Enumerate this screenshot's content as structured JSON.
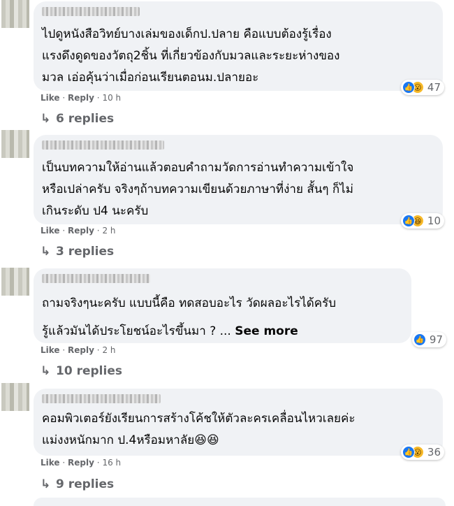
{
  "comments": [
    {
      "lines": [
        "ไปดูหนังสือวิทย์บางเล่มของเด็กป.ปลาย คือแบบต้องรู้เรื่อง",
        "แรงดึงดูดของวัตถุ2ชิ้น ที่เกี่ยวข้องกับมวลและระยะห่างของ",
        "มวล เอ่อคุ้นว่าเมื่อก่อนเรียนตอนม.ปลายอะ"
      ],
      "like": "Like",
      "reply": "Reply",
      "time": "10 h",
      "reaction_count": "47",
      "replies": "6 replies",
      "reaction_icons": [
        "like-icon",
        "wow-icon"
      ]
    },
    {
      "lines": [
        "เป็นบทความให้อ่านแล้วตอบคำถามวัดการอ่านทำความเข้าใจ",
        "หรือเปล่าครับ จริงๆถ้าบทความเขียนด้วยภาษาที่ง่าย สั้นๆ ก็ไม่",
        "เกินระดับ ป4 นะครับ"
      ],
      "like": "Like",
      "reply": "Reply",
      "time": "2 h",
      "reaction_count": "10",
      "replies": "3 replies",
      "reaction_icons": [
        "like-icon",
        "haha-icon"
      ]
    },
    {
      "lines": [
        "ถามจริงๆนะครับ แบบนี้คือ ทดสอบอะไร วัดผลอะไรได้ครับ",
        "รู้แล้วมันได้ประโยชน์อะไรขึ้นมา ? ..."
      ],
      "see_more": "See more",
      "like": "Like",
      "reply": "Reply",
      "time": "2 h",
      "reaction_count": "97",
      "replies": "10 replies",
      "reaction_icons": [
        "like-icon"
      ]
    },
    {
      "lines": [
        "คอมพิวเตอร์ยังเรียนการสร้างโค้ชให้ตัวละครเคลื่อนไหวเลยค่ะ",
        "แม่งงหนักมาก ป.4หรือมหาลัย😆😆"
      ],
      "like": "Like",
      "reply": "Reply",
      "time": "16 h",
      "reaction_count": "36",
      "replies": "9 replies",
      "reaction_icons": [
        "like-icon",
        "wow-icon"
      ]
    }
  ],
  "separator": "·",
  "reply_arrow": "↳"
}
